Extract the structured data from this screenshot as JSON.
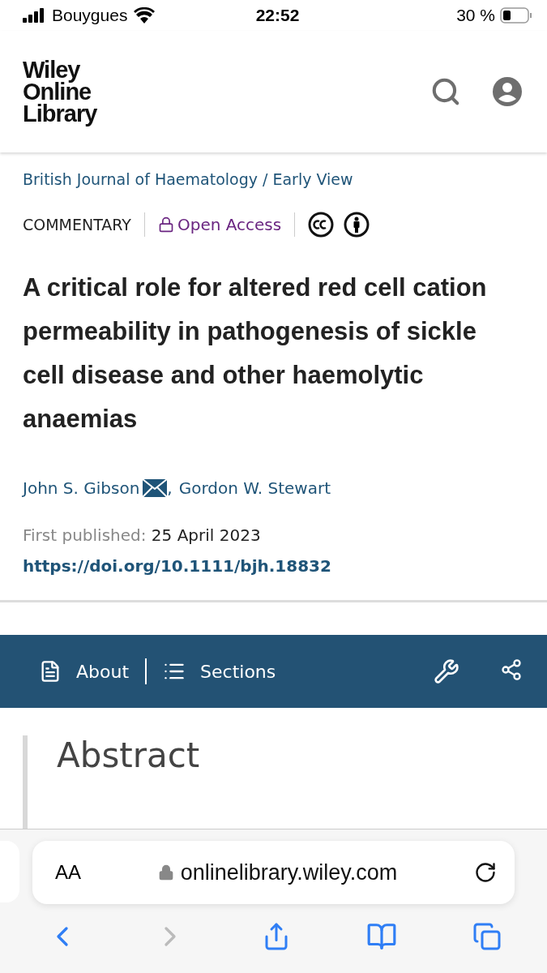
{
  "status_bar": {
    "carrier": "Bouygues",
    "time": "22:52",
    "battery": "30 %"
  },
  "header": {
    "logo_lines": [
      "Wiley",
      "Online",
      "Library"
    ]
  },
  "article": {
    "breadcrumb": "British Journal of Haematology / Early View",
    "type": "COMMENTARY",
    "access": "Open Access",
    "title": "A critical role for altered red cell cation permeability in pathogenesis of sickle cell disease and other haemolytic anaemias",
    "authors": [
      {
        "name": "John S. Gibson",
        "corresponding": true
      },
      {
        "name": "Gordon W. Stewart",
        "corresponding": false
      }
    ],
    "author_separator": ",",
    "published_label": "First published:",
    "published_date": "25 April 2023",
    "doi": "https://doi.org/10.1111/bjh.18832"
  },
  "article_nav": {
    "items": [
      {
        "label": "About",
        "kind": "document"
      },
      {
        "label": "Sections",
        "kind": "list"
      }
    ]
  },
  "abstract": {
    "heading": "Abstract"
  },
  "browser": {
    "text_size": "AA",
    "url": "onlinelibrary.wiley.com",
    "back_enabled": true,
    "forward_enabled": false
  }
}
